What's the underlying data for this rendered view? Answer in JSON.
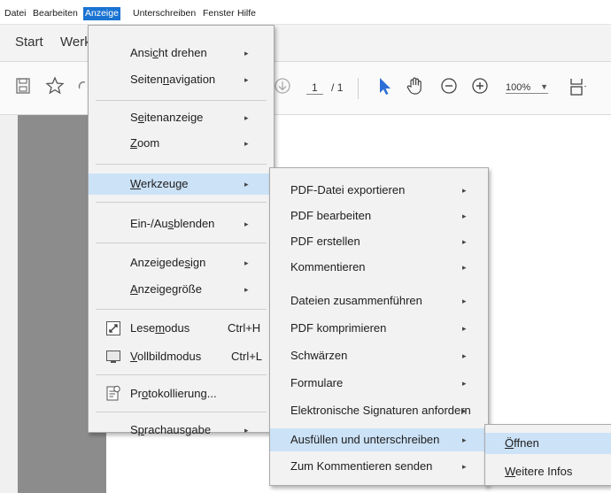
{
  "menubar": {
    "items": [
      "Datei",
      "Bearbeiten",
      "Anzeige",
      "Unterschreiben",
      "Fenster",
      "Hilfe"
    ],
    "active": "Anzeige"
  },
  "tabs": {
    "start": "Start",
    "werkzeuge_partial": "Werk"
  },
  "toolbar": {
    "page_current": "1",
    "page_total": "/ 1",
    "zoom": "100%"
  },
  "anzeige_menu": {
    "items": [
      {
        "pre": "Ansi",
        "u": "c",
        "post": "ht drehen",
        "arrow": "▸"
      },
      {
        "pre": "Seiten",
        "u": "n",
        "post": "avigation",
        "arrow": "▸"
      },
      {
        "pre": "S",
        "u": "e",
        "post": "itenanzeige",
        "arrow": "▸"
      },
      {
        "pre": "",
        "u": "Z",
        "post": "oom",
        "arrow": "▸"
      },
      {
        "pre": "",
        "u": "W",
        "post": "erkzeuge",
        "arrow": "▸"
      },
      {
        "pre": "Ein-/Au",
        "u": "s",
        "post": "blenden",
        "arrow": "▸"
      },
      {
        "pre": "Anzeigede",
        "u": "s",
        "post": "ign",
        "arrow": "▸"
      },
      {
        "pre": "",
        "u": "A",
        "post": "nzeigegröße",
        "arrow": "▸"
      },
      {
        "pre": "Lese",
        "u": "m",
        "post": "odus",
        "shortcut": "Ctrl+H"
      },
      {
        "pre": "",
        "u": "V",
        "post": "ollbildmodus",
        "shortcut": "Ctrl+L"
      },
      {
        "pre": "Pr",
        "u": "o",
        "post": "tokollierung...",
        "arrow": ""
      },
      {
        "pre": "S",
        "u": "p",
        "post": "rachausgabe",
        "arrow": "▸"
      }
    ]
  },
  "werkzeuge_menu": {
    "items": [
      "PDF-Datei exportieren",
      "PDF bearbeiten",
      "PDF erstellen",
      "Kommentieren",
      "Dateien zusammenführen",
      "PDF komprimieren",
      "Schwärzen",
      "Formulare",
      "Elektronische Signaturen anfordern",
      "Ausfüllen und unterschreiben",
      "Zum Kommentieren senden"
    ],
    "arrow": "▸"
  },
  "ausfuellen_menu": {
    "items": [
      {
        "pre": "",
        "u": "Ö",
        "post": "ffnen"
      },
      {
        "pre": "",
        "u": "W",
        "post": "eitere Infos"
      }
    ]
  },
  "colors": {
    "menu_active": "#1a73d1",
    "highlight": "#cce2f7",
    "hand_tool_blue": "#2b6fd6"
  }
}
